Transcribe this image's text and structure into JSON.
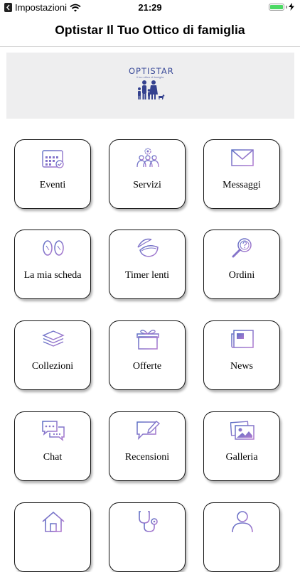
{
  "status_bar": {
    "back_app": "Impostazioni",
    "time": "21:29",
    "battery_level": 1.0
  },
  "nav": {
    "title": "Optistar Il Tuo Ottico di famiglia"
  },
  "banner": {
    "logo_text": "OPTISTAR",
    "logo_tagline": "Il tuo ottico di famiglia"
  },
  "colors": {
    "icon_gradient_start": "#5a6fc4",
    "icon_gradient_end": "#b07ad0",
    "banner_bg": "#eeeeef",
    "battery_green": "#4cd964"
  },
  "tiles": [
    {
      "label": "Eventi",
      "icon": "calendar-icon"
    },
    {
      "label": "Servizi",
      "icon": "team-gear-icon"
    },
    {
      "label": "Messaggi",
      "icon": "envelope-icon"
    },
    {
      "label": "La mia scheda",
      "icon": "eyeglasses-icon"
    },
    {
      "label": "Timer lenti",
      "icon": "contact-lens-icon"
    },
    {
      "label": "Ordini",
      "icon": "magnifier-icon"
    },
    {
      "label": "Collezioni",
      "icon": "layers-icon"
    },
    {
      "label": "Offerte",
      "icon": "gift-icon"
    },
    {
      "label": "News",
      "icon": "newspaper-icon"
    },
    {
      "label": "Chat",
      "icon": "chat-bubbles-icon"
    },
    {
      "label": "Recensioni",
      "icon": "review-icon"
    },
    {
      "label": "Galleria",
      "icon": "gallery-icon"
    },
    {
      "label": "",
      "icon": "home-icon"
    },
    {
      "label": "",
      "icon": "stethoscope-icon"
    },
    {
      "label": "",
      "icon": "user-icon"
    }
  ]
}
